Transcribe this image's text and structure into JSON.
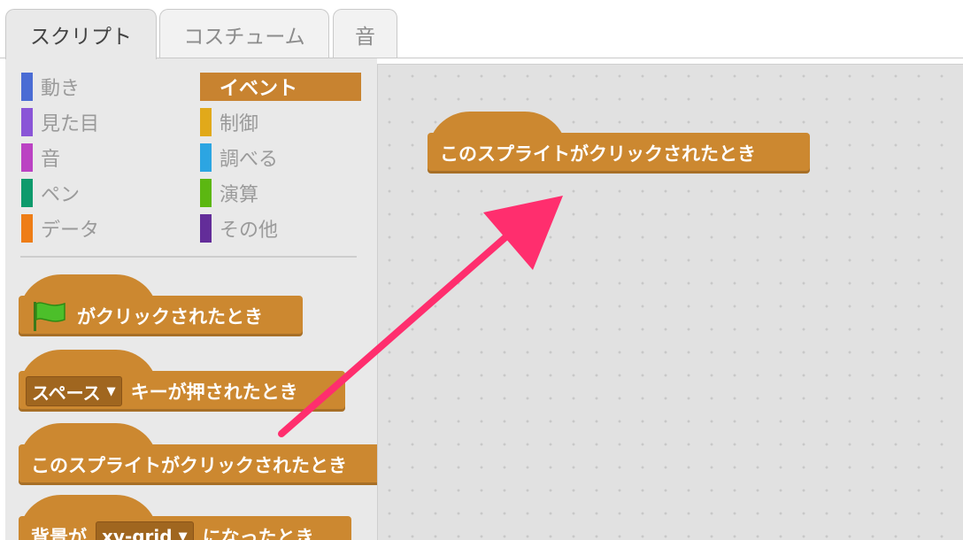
{
  "tabs": [
    {
      "label": "スクリプト",
      "active": true
    },
    {
      "label": "コスチューム",
      "active": false
    },
    {
      "label": "音",
      "active": false
    }
  ],
  "categories": {
    "motion": {
      "label": "動き",
      "color": "#4a6cd4"
    },
    "looks": {
      "label": "見た目",
      "color": "#8a55d7"
    },
    "sound": {
      "label": "音",
      "color": "#bb42c3"
    },
    "pen": {
      "label": "ペン",
      "color": "#0e9a6c"
    },
    "data": {
      "label": "データ",
      "color": "#ee7d16"
    },
    "events": {
      "label": "イベント",
      "color": "#c88330",
      "selected": true
    },
    "control": {
      "label": "制御",
      "color": "#e1a91a"
    },
    "sensing": {
      "label": "調べる",
      "color": "#2ca5e2"
    },
    "operators": {
      "label": "演算",
      "color": "#5cb712"
    },
    "more": {
      "label": "その他",
      "color": "#632d99"
    }
  },
  "palette_blocks": {
    "flag_clicked": {
      "label": "がクリックされたとき",
      "icon": "green-flag-icon"
    },
    "key_pressed": {
      "dropdown": "スペース",
      "label": "キーが押されたとき"
    },
    "sprite_clicked": {
      "label": "このスプライトがクリックされたとき"
    },
    "backdrop_switch": {
      "prefix": "背景が",
      "dropdown": "xy-grid",
      "label": "になったとき"
    }
  },
  "script_area": {
    "blocks": [
      {
        "label": "このスプライトがクリックされたとき"
      }
    ]
  },
  "annotation": {
    "arrow_color": "#ff2e6e"
  }
}
